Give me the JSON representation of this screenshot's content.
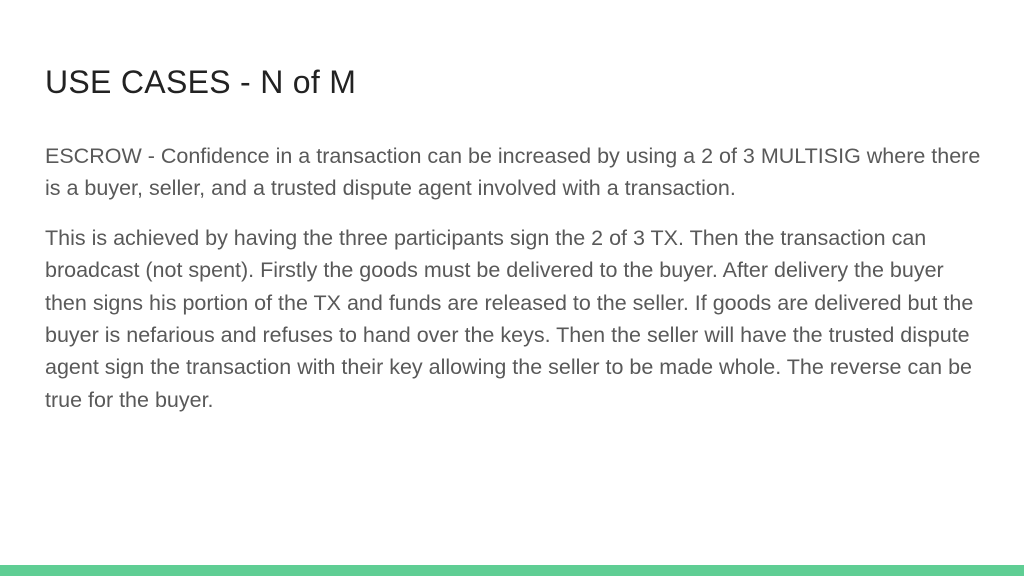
{
  "slide": {
    "title": "USE CASES - N of M",
    "paragraphs": [
      "ESCROW - Confidence in a transaction can be increased by using a 2 of 3 MULTISIG where there is a buyer, seller, and a trusted dispute agent involved with a transaction.",
      "This is achieved by having the three participants sign the 2 of 3 TX. Then the transaction can broadcast (not spent). Firstly the goods must be delivered to the buyer. After delivery the buyer then signs his portion of the TX and funds are released to the seller. If goods are delivered but the buyer is nefarious and refuses to hand over the keys. Then the seller will have the trusted dispute agent sign the transaction with their key allowing the seller to be made whole. The reverse can be true for the buyer."
    ]
  },
  "colors": {
    "accent_bar": "#5fce94",
    "title_text": "#222222",
    "body_text": "#595959",
    "background": "#ffffff"
  }
}
